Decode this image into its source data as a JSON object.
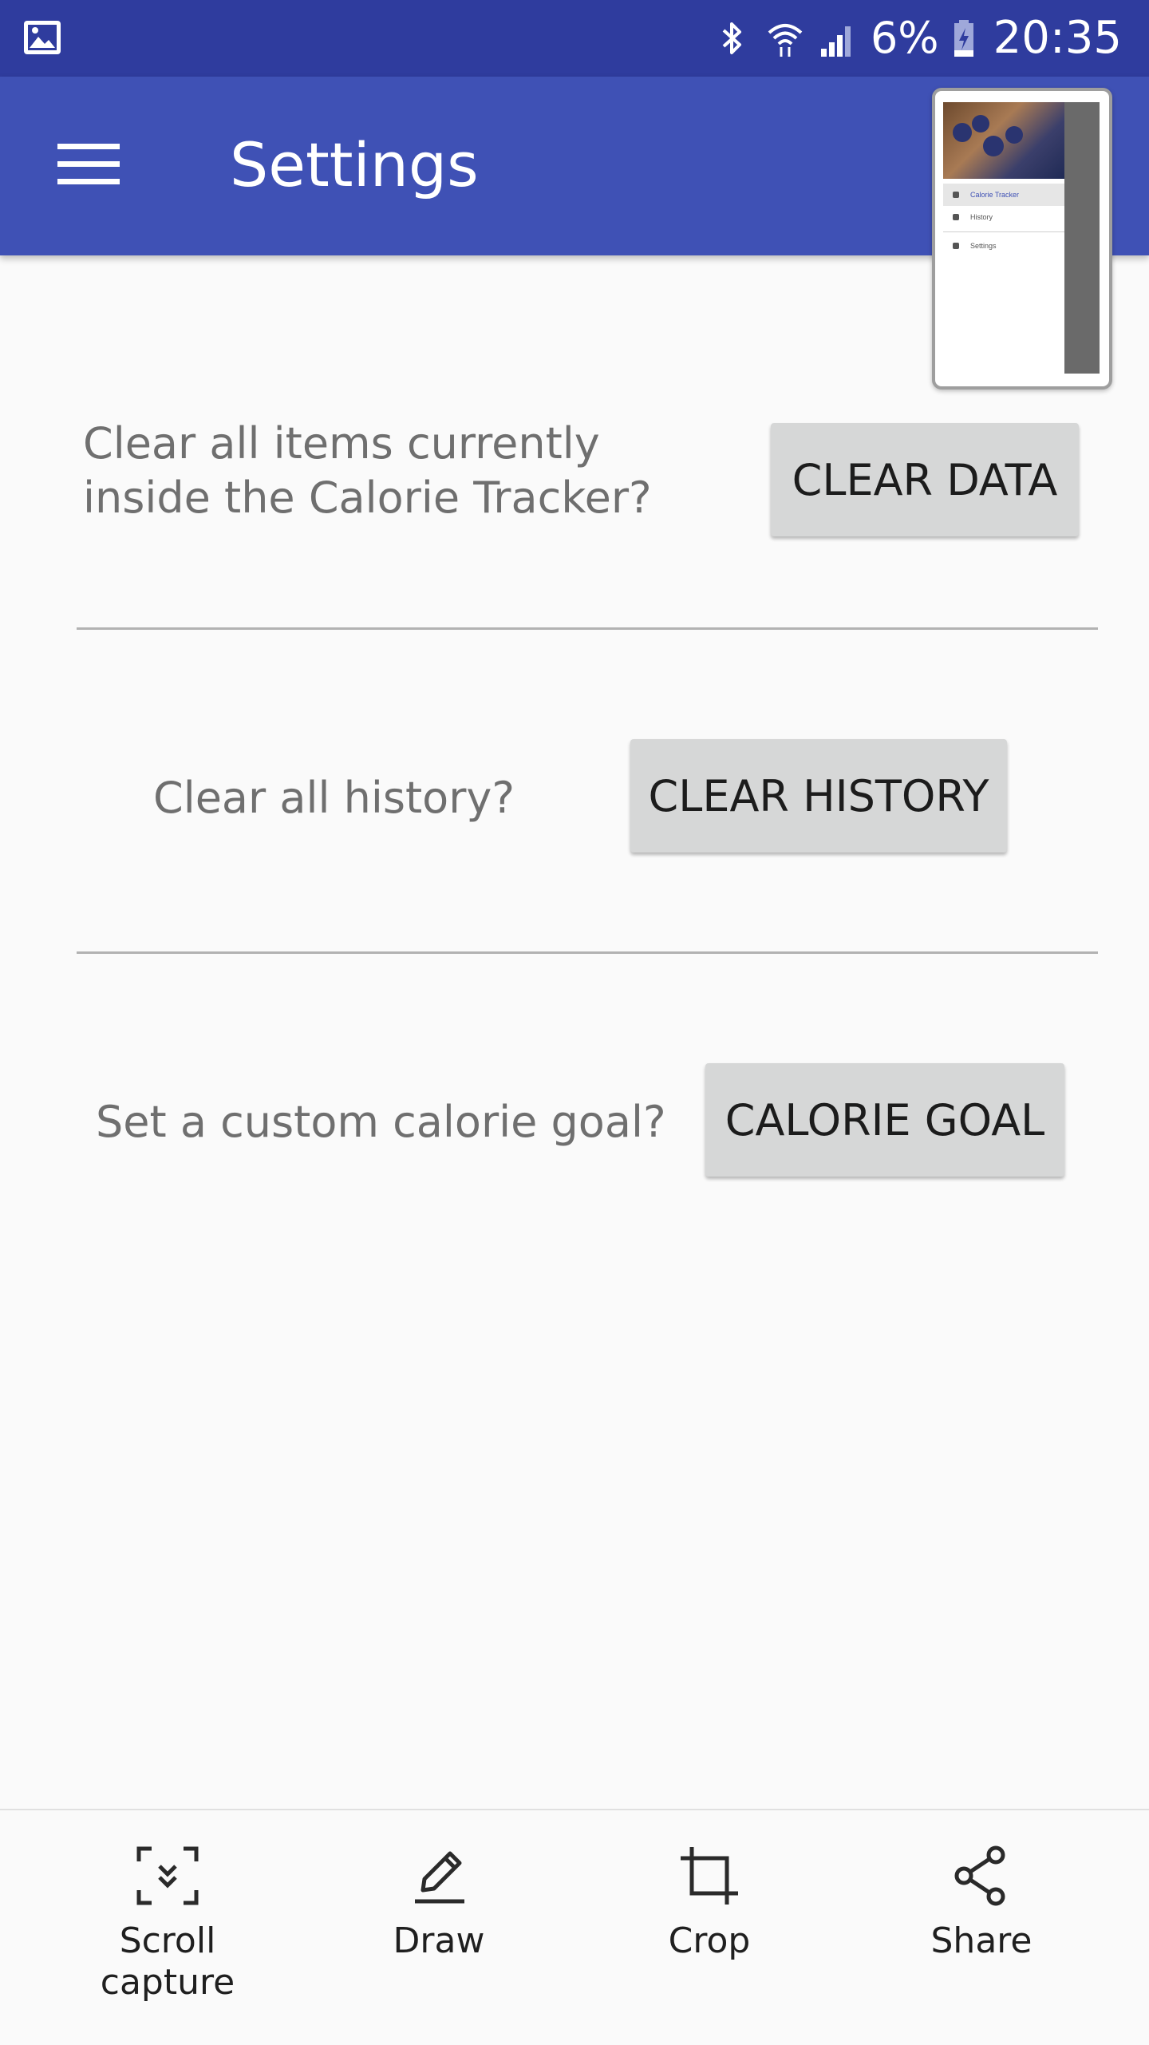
{
  "status_bar": {
    "battery_percent": "6%",
    "time": "20:35",
    "icons": [
      "gallery-icon",
      "bluetooth-icon",
      "wifi-icon",
      "signal-icon",
      "battery-charging-icon"
    ]
  },
  "app_bar": {
    "title": "Settings",
    "menu_icon": "hamburger-menu-icon",
    "color": "#3f51b5"
  },
  "thumbnail": {
    "items": [
      {
        "label": "Calorie Tracker",
        "active": true
      },
      {
        "label": "History",
        "active": false
      },
      {
        "label": "Settings",
        "active": false
      }
    ]
  },
  "settings": {
    "clear_data": {
      "prompt": "Clear all items currently inside the Calorie Tracker?",
      "button": "CLEAR DATA"
    },
    "clear_history": {
      "prompt": "Clear all history?",
      "button": "CLEAR HISTORY"
    },
    "calorie_goal": {
      "prompt": "Set a custom calorie goal?",
      "button": "CALORIE GOAL"
    }
  },
  "bottom_toolbar": {
    "items": [
      {
        "label": "Scroll capture",
        "icon": "scroll-capture-icon"
      },
      {
        "label": "Draw",
        "icon": "draw-icon"
      },
      {
        "label": "Crop",
        "icon": "crop-icon"
      },
      {
        "label": "Share",
        "icon": "share-icon"
      }
    ]
  }
}
